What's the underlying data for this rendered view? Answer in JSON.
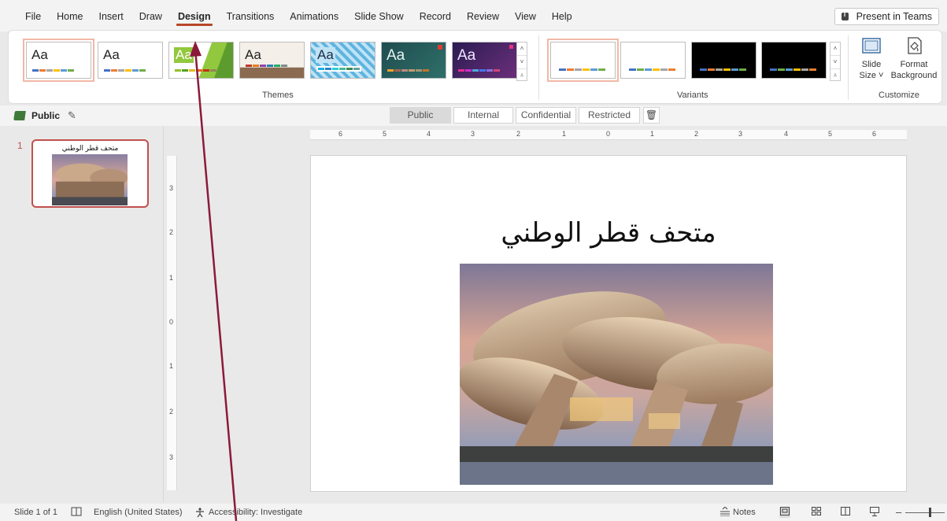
{
  "menu": {
    "items": [
      "File",
      "Home",
      "Insert",
      "Draw",
      "Design",
      "Transitions",
      "Animations",
      "Slide Show",
      "Record",
      "Review",
      "View",
      "Help"
    ],
    "active": "Design",
    "present_button": "Present in Teams"
  },
  "ribbon": {
    "themes_label": "Themes",
    "variants_label": "Variants",
    "customize_label": "Customize",
    "theme_sample_text": "Aa",
    "slide_size_line1": "Slide",
    "slide_size_line2": "Size ˅",
    "format_bg_line1": "Format",
    "format_bg_line2": "Background",
    "scroll_up": "˄",
    "scroll_down": "˅",
    "scroll_more": "⩡"
  },
  "sensitivity": {
    "current_label": "Public",
    "options": [
      "Public",
      "Internal",
      "Confidential",
      "Restricted"
    ],
    "selected": "Public",
    "delete_icon": "🗑",
    "edit_icon": "✎"
  },
  "thumbnails": {
    "slide_number": "1",
    "title": "متحف قطر الوطني"
  },
  "slide": {
    "title": "متحف قطر الوطني"
  },
  "rulers": {
    "horizontal": [
      "6",
      "5",
      "4",
      "3",
      "2",
      "1",
      "0",
      "1",
      "2",
      "3",
      "4",
      "5",
      "6"
    ],
    "vertical": [
      "3",
      "2",
      "1",
      "0",
      "1",
      "2",
      "3"
    ]
  },
  "status": {
    "slide_info": "Slide 1 of 1",
    "language": "English (United States)",
    "accessibility": "Accessibility: Investigate",
    "notes": "Notes",
    "zoom_minus": "–",
    "zoom_plus": "+"
  },
  "colors": {
    "accent": "#b7472a",
    "annotation_arrow": "#8b1a3a",
    "sensitivity_tag": "#3f7a3a"
  }
}
